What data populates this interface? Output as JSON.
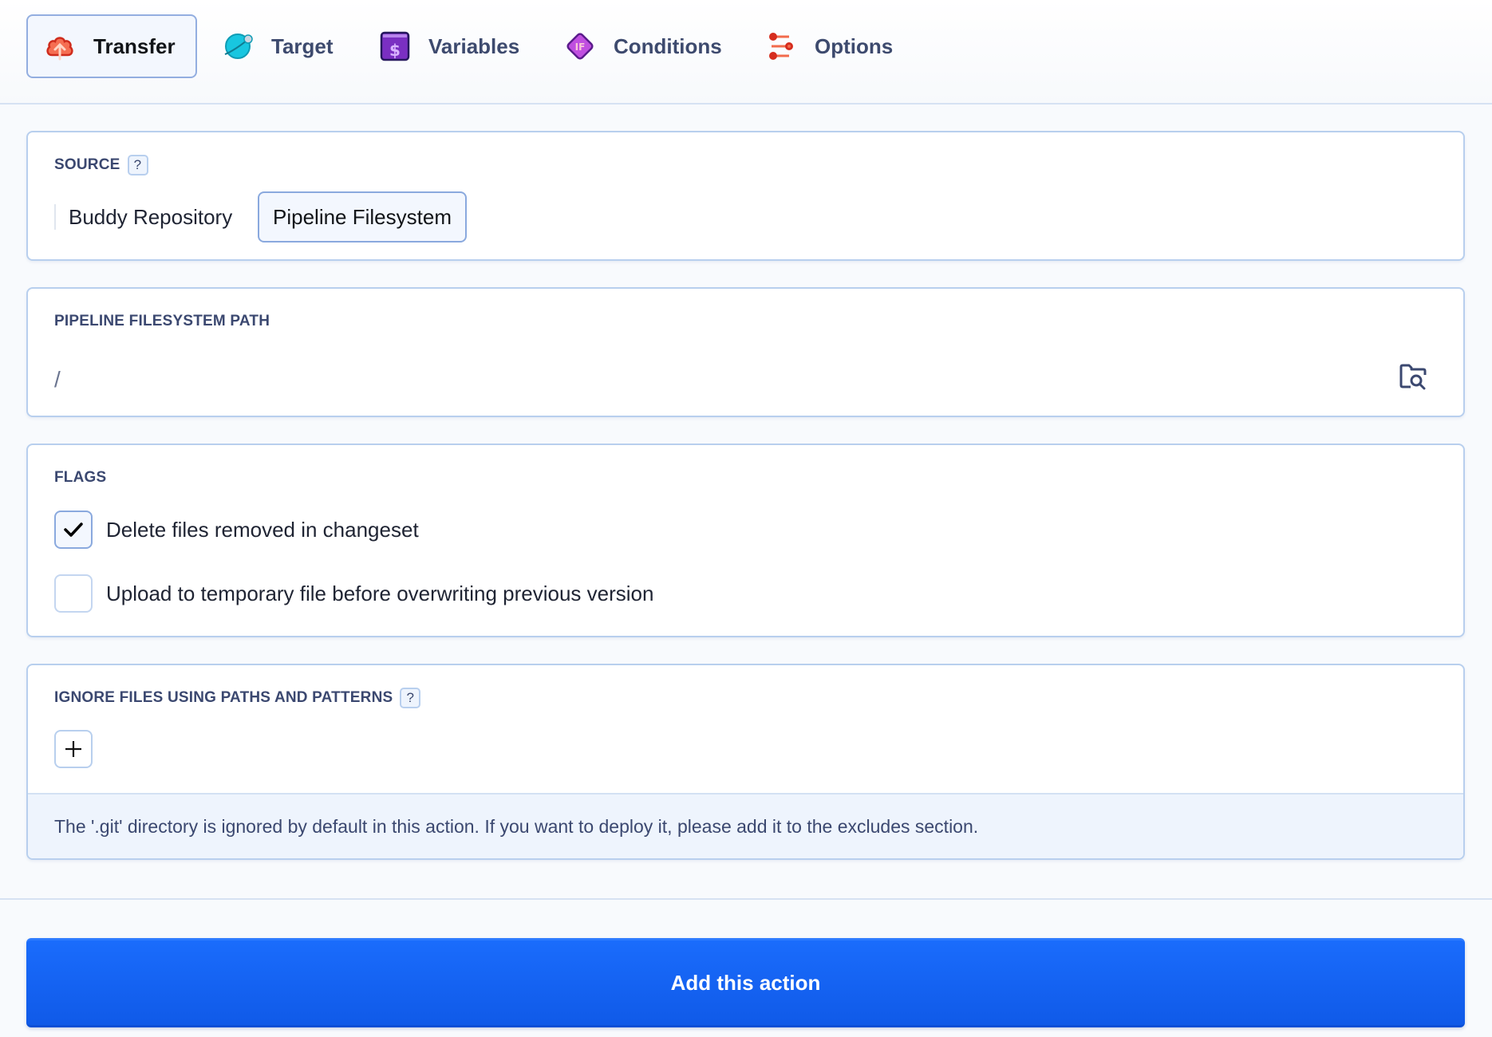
{
  "tabs": [
    {
      "label": "Transfer",
      "icon": "cloud-upload-icon",
      "active": true
    },
    {
      "label": "Target",
      "icon": "planet-icon",
      "active": false
    },
    {
      "label": "Variables",
      "icon": "dollar-variable-icon",
      "active": false
    },
    {
      "label": "Conditions",
      "icon": "if-diamond-icon",
      "active": false
    },
    {
      "label": "Options",
      "icon": "sliders-icon",
      "active": false
    }
  ],
  "source": {
    "label": "SOURCE",
    "help": "?",
    "options": [
      "Buddy Repository",
      "Pipeline Filesystem"
    ],
    "selected": "Pipeline Filesystem"
  },
  "path": {
    "label": "PIPELINE FILESYSTEM PATH",
    "value": "/",
    "browse_icon": "folder-search-icon"
  },
  "flags": {
    "label": "FLAGS",
    "items": [
      {
        "label": "Delete files removed in changeset",
        "checked": true
      },
      {
        "label": "Upload to temporary file before overwriting previous version",
        "checked": false
      }
    ]
  },
  "ignore": {
    "label": "IGNORE FILES USING PATHS AND PATTERNS",
    "help": "?",
    "add_symbol": "+",
    "info": "The '.git' directory is ignored by default in this action. If you want to deploy it, please add it to the excludes section."
  },
  "actions": {
    "primary_label": "Add this action",
    "primary_color": "#1563f5"
  },
  "colors": {
    "card_border": "#b8cfee",
    "accent": "#1563f5"
  }
}
